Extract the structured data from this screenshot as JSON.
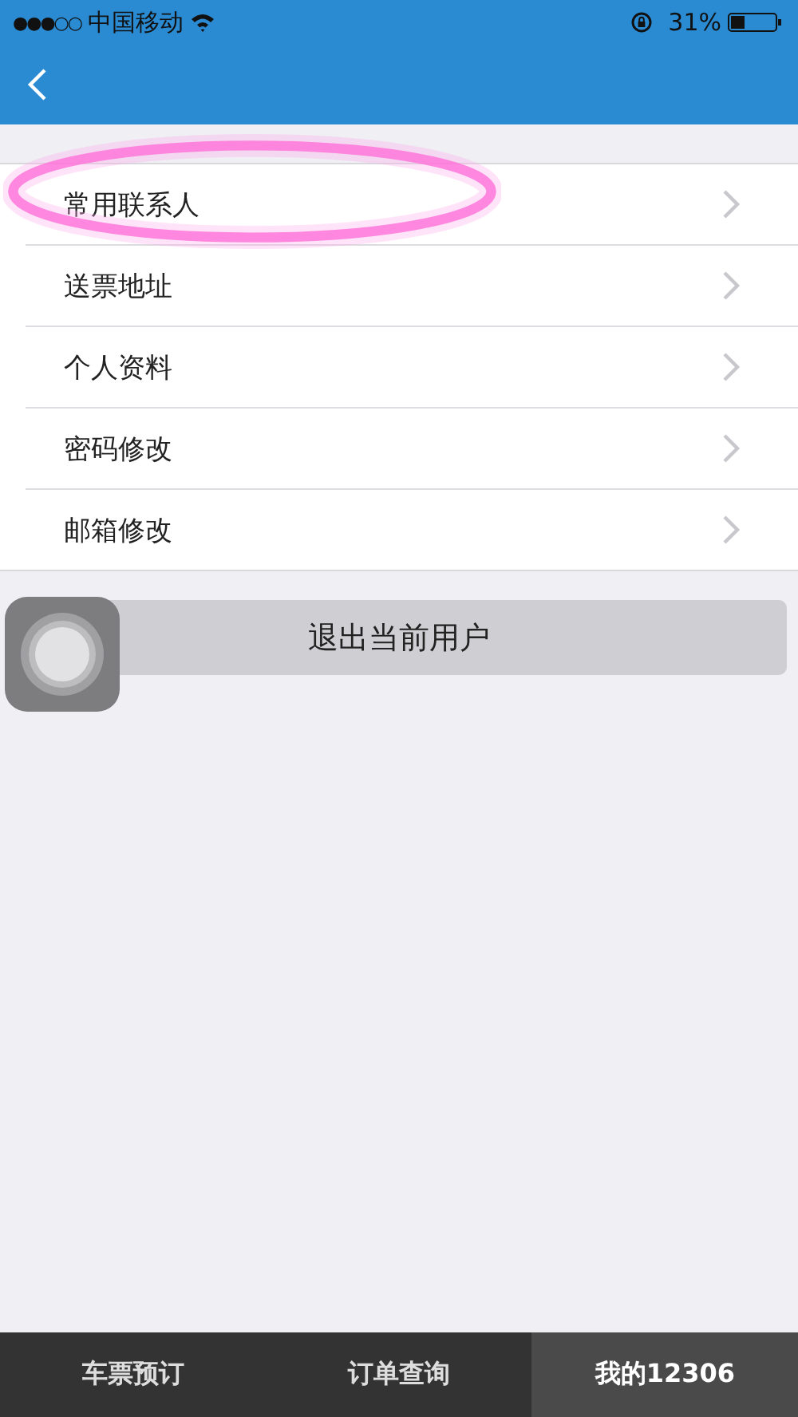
{
  "status_bar": {
    "signal_dots": "●●●○○",
    "carrier": "中国移动",
    "battery_text": "31%"
  },
  "menu": [
    {
      "label": "常用联系人",
      "highlighted": true
    },
    {
      "label": "送票地址",
      "highlighted": false
    },
    {
      "label": "个人资料",
      "highlighted": false
    },
    {
      "label": "密码修改",
      "highlighted": false
    },
    {
      "label": "邮箱修改",
      "highlighted": false
    }
  ],
  "logout_button": "退出当前用户",
  "tabs": [
    {
      "label": "车票预订",
      "selected": false
    },
    {
      "label": "订单查询",
      "selected": false
    },
    {
      "label": "我的12306",
      "selected": true
    }
  ]
}
